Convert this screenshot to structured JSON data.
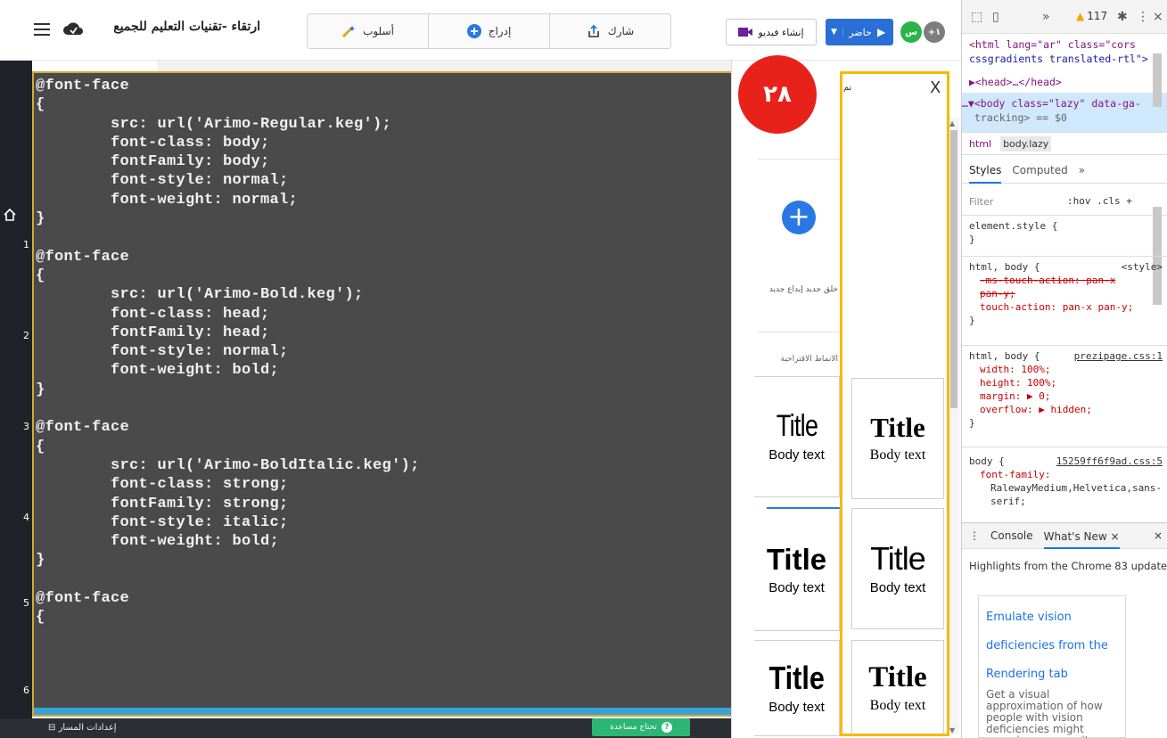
{
  "app": {
    "title": "ارتقاء -تقنيات التعليم للجميع",
    "toolbar": {
      "share": "شارك",
      "insert": "إدراج",
      "style": "أسلوب"
    },
    "create_video": "إنشاء فيديو",
    "present": "حاضر",
    "avatar_green": "س",
    "avatar_gray": "+١",
    "bottom": {
      "path_settings": "إعدادات المسار",
      "help": "تحتاج مساعدة"
    }
  },
  "slide_numbers": [
    "1",
    "2",
    "3",
    "4",
    "5",
    "6"
  ],
  "code": {
    "text": "@font-face\n{\n        src: url('Arimo-Regular.keg');\n        font-class: body;\n        fontFamily: body;\n        font-style: normal;\n        font-weight: normal;\n}\n\n@font-face\n{\n        src: url('Arimo-Bold.keg');\n        font-class: head;\n        fontFamily: head;\n        font-style: normal;\n        font-weight: bold;\n}\n\n@font-face\n{\n        src: url('Arimo-BoldItalic.keg');\n        font-class: strong;\n        fontFamily: strong;\n        font-style: italic;\n        font-weight: bold;\n}\n\n@font-face\n{"
  },
  "badge": "٢٨",
  "style_panel": {
    "close": "X",
    "title_fragment": "نم",
    "new_creative": "خلق جديد إبداع جديد",
    "suggested": "الأنماط الاقتراحية",
    "cards": [
      {
        "title": "Title",
        "body": "Body text"
      },
      {
        "title": "Title",
        "body": "Body text"
      },
      {
        "title": "Title",
        "body": "Body text"
      },
      {
        "title": "Title",
        "body": "Body text"
      },
      {
        "title": "Title",
        "body": "Body text"
      },
      {
        "title": "Title",
        "body": "Body text"
      }
    ]
  },
  "devtools": {
    "warnings": "117",
    "dom": {
      "l1": "<html lang=\"ar\" class=\"cors",
      "l2": "cssgradients translated-rtl\">",
      "l3": "▶<head>…</head>",
      "l4": "…▼<body class=\"lazy\" data-ga-",
      "l5": "tracking> == $0"
    },
    "crumbs": [
      "html",
      "body.lazy"
    ],
    "tabs": [
      "Styles",
      "Computed",
      "»"
    ],
    "filter_placeholder": "Filter",
    "filter_opts": ":hov  .cls  +",
    "blocks": [
      {
        "selector": "element.style {",
        "source": "",
        "lines": [],
        "close": "}"
      },
      {
        "selector": "html, body {",
        "source": "<style>",
        "strike": "-ms-touch-action: pan-x pan-y;",
        "lines": [
          "touch-action: pan-x pan-y;"
        ],
        "close": "}"
      },
      {
        "selector": "html, body {",
        "source": "prezipage.css:1",
        "lines": [
          "width: 100%;",
          "height: 100%;",
          "margin: ▶ 0;",
          "overflow: ▶ hidden;"
        ],
        "close": "}"
      },
      {
        "selector": "body {",
        "source": "15259ff6f9ad.css:5",
        "lines": [
          "font-family:",
          "RalewayMedium,Helvetica,sans-",
          "serif;"
        ],
        "close": ""
      }
    ],
    "console_tabs": [
      "Console",
      "What's New ×"
    ],
    "highlights": "Highlights from the Chrome 83 update",
    "news_title_lines": [
      "Emulate vision",
      "deficiencies from the",
      "Rendering tab"
    ],
    "news_desc": "Get a visual approximation of how people with vision deficiencies might experience your site."
  },
  "colors": {
    "accent_blue": "#2a6fd6",
    "badge_red": "#e8221b",
    "highlight_yellow": "#f7b900",
    "code_bg": "#4a4a4a"
  }
}
